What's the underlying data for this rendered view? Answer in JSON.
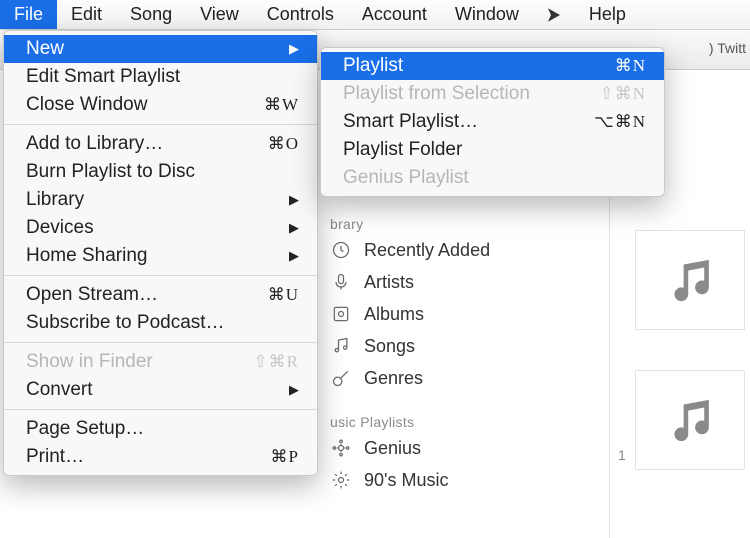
{
  "menubar": {
    "items": [
      "File",
      "Edit",
      "Song",
      "View",
      "Controls",
      "Account",
      "Window"
    ],
    "help": "Help",
    "selected": "File"
  },
  "toolbar": {
    "rightText": ") Twitt"
  },
  "fileMenu": {
    "new": "New",
    "editSmart": "Edit Smart Playlist",
    "closeWindow": "Close Window",
    "closeWindowShort": "⌘W",
    "addToLibrary": "Add to Library…",
    "addToLibraryShort": "⌘O",
    "burn": "Burn Playlist to Disc",
    "library": "Library",
    "devices": "Devices",
    "homeSharing": "Home Sharing",
    "openStream": "Open Stream…",
    "openStreamShort": "⌘U",
    "subscribe": "Subscribe to Podcast…",
    "showInFinder": "Show in Finder",
    "showInFinderShort": "⇧⌘R",
    "convert": "Convert",
    "pageSetup": "Page Setup…",
    "print": "Print…",
    "printShort": "⌘P"
  },
  "newSubmenu": {
    "playlist": "Playlist",
    "playlistShort": "⌘N",
    "fromSelection": "Playlist from Selection",
    "fromSelectionShort": "⇧⌘N",
    "smart": "Smart Playlist…",
    "smartShort": "⌥⌘N",
    "folder": "Playlist Folder",
    "genius": "Genius Playlist"
  },
  "sidebar": {
    "libraryHeader": "brary",
    "recentlyAdded": "Recently Added",
    "artists": "Artists",
    "albums": "Albums",
    "songs": "Songs",
    "genres": "Genres",
    "playlistsHeader": "usic Playlists",
    "geniusItem": "Genius",
    "nineties": "90's Music"
  },
  "thumb": {
    "num": "1"
  }
}
